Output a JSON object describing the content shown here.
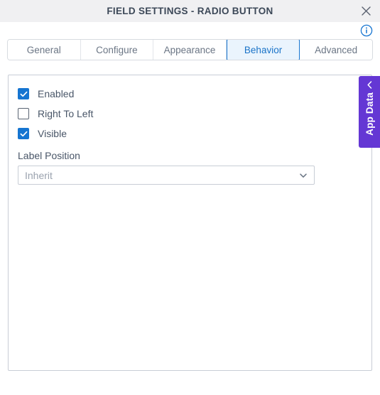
{
  "window": {
    "title": "FIELD SETTINGS - RADIO BUTTON",
    "close_icon": "close-icon"
  },
  "header": {
    "info_icon": "info-circle-icon"
  },
  "tabs": [
    {
      "label": "General",
      "active": false
    },
    {
      "label": "Configure",
      "active": false
    },
    {
      "label": "Appearance",
      "active": false
    },
    {
      "label": "Behavior",
      "active": true
    },
    {
      "label": "Advanced",
      "active": false
    }
  ],
  "form": {
    "checkboxes": [
      {
        "label": "Enabled",
        "checked": true
      },
      {
        "label": "Right To Left",
        "checked": false
      },
      {
        "label": "Visible",
        "checked": true
      }
    ],
    "label_position": {
      "label": "Label Position",
      "value": "Inherit",
      "chevron_icon": "chevron-down-icon"
    }
  },
  "side_panel": {
    "label": "App Data",
    "chevron_icon": "chevron-left-icon"
  },
  "colors": {
    "titlebar_bg": "#f0f0f2",
    "title_text": "#3c4858",
    "accent_blue": "#1675d1",
    "active_tab_bg": "#eaf4fd",
    "active_tab_border": "#1775d1",
    "panel_border": "#c8cdd6",
    "label_text": "#495668",
    "placeholder_text": "#9aa2ae",
    "app_data_purple": "#6437d4"
  }
}
